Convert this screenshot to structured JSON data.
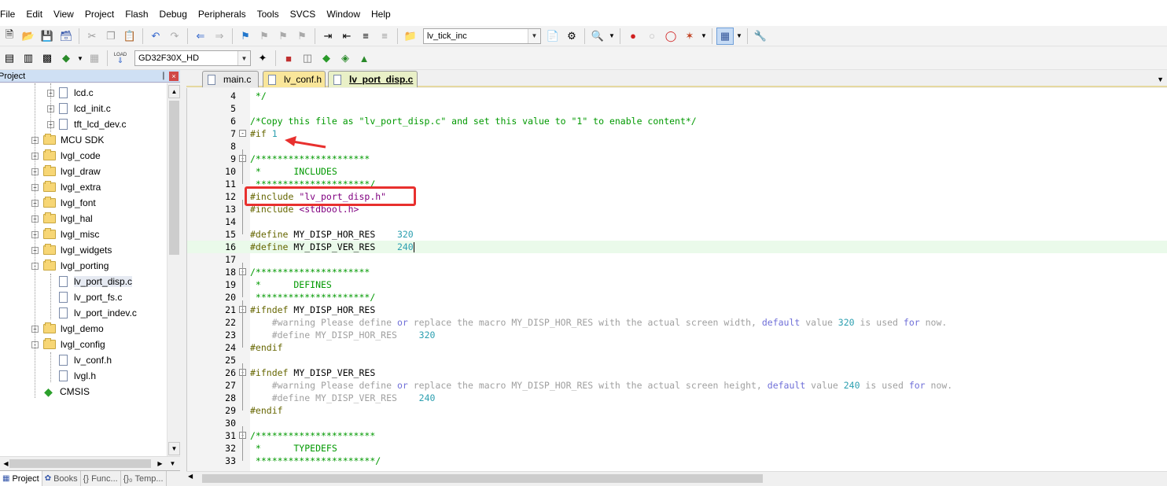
{
  "menu": [
    "File",
    "Edit",
    "View",
    "Project",
    "Flash",
    "Debug",
    "Peripherals",
    "Tools",
    "SVCS",
    "Window",
    "Help"
  ],
  "toolbar1": {
    "find_combo": "lv_tick_inc"
  },
  "toolbar2": {
    "target_combo": "GD32F30X_HD",
    "load_label": "LOAD"
  },
  "project_panel": {
    "title": "Project",
    "pin": "❘",
    "close": "×",
    "items": [
      {
        "label": "lcd.c",
        "kind": "file",
        "level": 2,
        "expander": "+"
      },
      {
        "label": "lcd_init.c",
        "kind": "file",
        "level": 2,
        "expander": "+"
      },
      {
        "label": "tft_lcd_dev.c",
        "kind": "file",
        "level": 2,
        "expander": "+"
      },
      {
        "label": "MCU SDK",
        "kind": "folder",
        "level": 1,
        "expander": "+"
      },
      {
        "label": "lvgl_code",
        "kind": "folder",
        "level": 1,
        "expander": "+"
      },
      {
        "label": "lvgl_draw",
        "kind": "folder",
        "level": 1,
        "expander": "+"
      },
      {
        "label": "lvgl_extra",
        "kind": "folder",
        "level": 1,
        "expander": "+"
      },
      {
        "label": "lvgl_font",
        "kind": "folder",
        "level": 1,
        "expander": "+"
      },
      {
        "label": "lvgl_hal",
        "kind": "folder",
        "level": 1,
        "expander": "+"
      },
      {
        "label": "lvgl_misc",
        "kind": "folder",
        "level": 1,
        "expander": "+"
      },
      {
        "label": "lvgl_widgets",
        "kind": "folder",
        "level": 1,
        "expander": "+"
      },
      {
        "label": "lvgl_porting",
        "kind": "folder",
        "level": 1,
        "expander": "-"
      },
      {
        "label": "lv_port_disp.c",
        "kind": "file",
        "level": 2,
        "expander": "",
        "selected": true
      },
      {
        "label": "lv_port_fs.c",
        "kind": "file",
        "level": 2,
        "expander": ""
      },
      {
        "label": "lv_port_indev.c",
        "kind": "file",
        "level": 2,
        "expander": ""
      },
      {
        "label": "lvgl_demo",
        "kind": "folder",
        "level": 1,
        "expander": "+"
      },
      {
        "label": "lvgl_config",
        "kind": "folder",
        "level": 1,
        "expander": "-"
      },
      {
        "label": "lv_conf.h",
        "kind": "file",
        "level": 2,
        "expander": ""
      },
      {
        "label": "lvgl.h",
        "kind": "file",
        "level": 2,
        "expander": ""
      },
      {
        "label": "CMSIS",
        "kind": "gem",
        "level": 1,
        "expander": ""
      }
    ]
  },
  "bottom_tabs": [
    "Project",
    "Books",
    "{} Func...",
    "{}₀ Temp..."
  ],
  "editor_tabs": [
    {
      "label": "main.c",
      "state": "normal"
    },
    {
      "label": "lv_conf.h",
      "state": "yellow"
    },
    {
      "label": "lv_port_disp.c",
      "state": "active"
    }
  ],
  "code_lines": [
    {
      "n": "4",
      "fold": "",
      "segs": [
        [
          " */",
          "comment"
        ]
      ]
    },
    {
      "n": "5",
      "fold": "",
      "segs": []
    },
    {
      "n": "6",
      "fold": "",
      "segs": [
        [
          "/*Copy this file as \"lv_port_disp.c\" and set this value to \"1\" to enable content*/",
          "comment"
        ]
      ]
    },
    {
      "n": "7",
      "fold": "-",
      "segs": [
        [
          "#if ",
          "pre"
        ],
        [
          "1",
          "num"
        ]
      ]
    },
    {
      "n": "8",
      "fold": "",
      "segs": []
    },
    {
      "n": "9",
      "fold": "-",
      "segs": [
        [
          "/*********************",
          "comment"
        ]
      ]
    },
    {
      "n": "10",
      "fold": "",
      "segs": [
        [
          " *      INCLUDES",
          "comment"
        ]
      ]
    },
    {
      "n": "11",
      "fold": "",
      "segs": [
        [
          " *********************/",
          "comment"
        ]
      ]
    },
    {
      "n": "12",
      "fold": "",
      "segs": [
        [
          "#include ",
          "pre"
        ],
        [
          "\"lv_port_disp.h\"",
          "str"
        ]
      ]
    },
    {
      "n": "13",
      "fold": "",
      "segs": [
        [
          "#include ",
          "pre"
        ],
        [
          "<stdbool.h>",
          "str"
        ]
      ]
    },
    {
      "n": "14",
      "fold": "",
      "segs": []
    },
    {
      "n": "15",
      "fold": "",
      "segs": [
        [
          "#define ",
          "pre"
        ],
        [
          "MY_DISP_HOR_RES    ",
          "plain"
        ],
        [
          "320",
          "num"
        ]
      ]
    },
    {
      "n": "16",
      "fold": "",
      "hl": true,
      "cursor": true,
      "segs": [
        [
          "#define ",
          "pre"
        ],
        [
          "MY_DISP_VER_RES    ",
          "plain"
        ],
        [
          "240",
          "num"
        ]
      ]
    },
    {
      "n": "17",
      "fold": "",
      "segs": []
    },
    {
      "n": "18",
      "fold": "-",
      "segs": [
        [
          "/*********************",
          "comment"
        ]
      ]
    },
    {
      "n": "19",
      "fold": "",
      "segs": [
        [
          " *      DEFINES",
          "comment"
        ]
      ]
    },
    {
      "n": "20",
      "fold": "",
      "segs": [
        [
          " *********************/",
          "comment"
        ]
      ]
    },
    {
      "n": "21",
      "fold": "-",
      "segs": [
        [
          "#ifndef ",
          "pre"
        ],
        [
          "MY_DISP_HOR_RES",
          "plain"
        ]
      ]
    },
    {
      "n": "22",
      "fold": "",
      "segs": [
        [
          "    #warning ",
          "dispre"
        ],
        [
          "Please define ",
          "dis"
        ],
        [
          "or",
          "kw"
        ],
        [
          " replace the macro MY_DISP_HOR_RES with the actual screen width, ",
          "dis"
        ],
        [
          "default",
          "kw"
        ],
        [
          " value ",
          "dis"
        ],
        [
          "320",
          "num"
        ],
        [
          " is used ",
          "dis"
        ],
        [
          "for",
          "kw"
        ],
        [
          " now.",
          "dis"
        ]
      ]
    },
    {
      "n": "23",
      "fold": "",
      "segs": [
        [
          "    #define ",
          "dispre"
        ],
        [
          "MY_DISP_HOR_RES    ",
          "dis"
        ],
        [
          "320",
          "num"
        ]
      ]
    },
    {
      "n": "24",
      "fold": "",
      "segs": [
        [
          "#endif",
          "pre"
        ]
      ]
    },
    {
      "n": "25",
      "fold": "",
      "segs": []
    },
    {
      "n": "26",
      "fold": "-",
      "segs": [
        [
          "#ifndef ",
          "pre"
        ],
        [
          "MY_DISP_VER_RES",
          "plain"
        ]
      ]
    },
    {
      "n": "27",
      "fold": "",
      "segs": [
        [
          "    #warning ",
          "dispre"
        ],
        [
          "Please define ",
          "dis"
        ],
        [
          "or",
          "kw"
        ],
        [
          " replace the macro MY_DISP_HOR_RES with the actual screen height, ",
          "dis"
        ],
        [
          "default",
          "kw"
        ],
        [
          " value ",
          "dis"
        ],
        [
          "240",
          "num"
        ],
        [
          " is used ",
          "dis"
        ],
        [
          "for",
          "kw"
        ],
        [
          " now.",
          "dis"
        ]
      ]
    },
    {
      "n": "28",
      "fold": "",
      "segs": [
        [
          "    #define ",
          "dispre"
        ],
        [
          "MY_DISP_VER_RES    ",
          "dis"
        ],
        [
          "240",
          "num"
        ]
      ]
    },
    {
      "n": "29",
      "fold": "",
      "segs": [
        [
          "#endif",
          "pre"
        ]
      ]
    },
    {
      "n": "30",
      "fold": "",
      "segs": []
    },
    {
      "n": "31",
      "fold": "-",
      "segs": [
        [
          "/**********************",
          "comment"
        ]
      ]
    },
    {
      "n": "32",
      "fold": "",
      "segs": [
        [
          " *      TYPEDEFS",
          "comment"
        ]
      ]
    },
    {
      "n": "33",
      "fold": "",
      "segs": [
        [
          " **********************/",
          "comment"
        ]
      ]
    }
  ],
  "colors": {
    "comment": "#009900",
    "preprocessor": "#666600",
    "string": "#800080",
    "number": "#2c9fb0",
    "keyword": "#6f6fd8",
    "annotation_red": "#e8302e",
    "current_line": "#eafaea"
  }
}
